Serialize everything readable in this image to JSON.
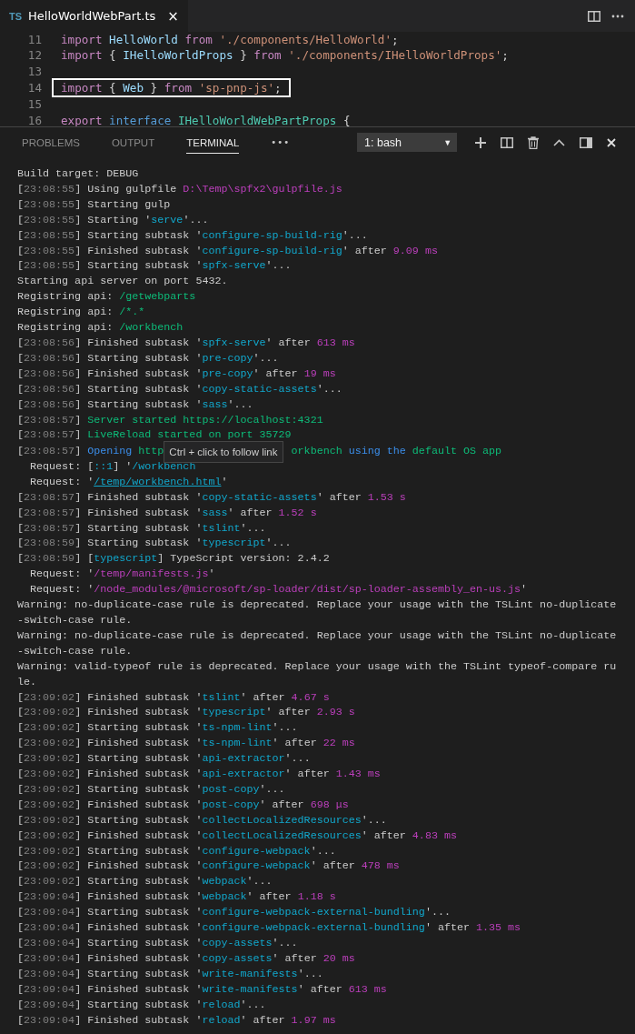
{
  "editor_tab": {
    "badge": "TS",
    "title": "HelloWorldWebPart.ts",
    "close": "×",
    "selected": true
  },
  "editor": {
    "lines": [
      {
        "number": "11",
        "highlighted": false,
        "tokens": [
          {
            "kind": "keyword",
            "text": "import "
          },
          {
            "kind": "ident",
            "text": "HelloWorld "
          },
          {
            "kind": "keyword",
            "text": "from "
          },
          {
            "kind": "string",
            "text": "'./components/HelloWorld'"
          },
          {
            "kind": "plain",
            "text": ";"
          }
        ]
      },
      {
        "number": "12",
        "highlighted": false,
        "tokens": [
          {
            "kind": "keyword",
            "text": "import"
          },
          {
            "kind": "plain",
            "text": " { "
          },
          {
            "kind": "ident",
            "text": "IHelloWorldProps"
          },
          {
            "kind": "plain",
            "text": " } "
          },
          {
            "kind": "keyword",
            "text": "from "
          },
          {
            "kind": "string",
            "text": "'./components/IHelloWorldProps'"
          },
          {
            "kind": "plain",
            "text": ";"
          }
        ]
      },
      {
        "number": "13",
        "highlighted": false
      },
      {
        "number": "14",
        "highlighted": true,
        "tokens": [
          {
            "kind": "keyword",
            "text": "import"
          },
          {
            "kind": "plain",
            "text": " { "
          },
          {
            "kind": "ident",
            "text": "Web"
          },
          {
            "kind": "plain",
            "text": " } "
          },
          {
            "kind": "keyword",
            "text": "from "
          },
          {
            "kind": "string",
            "text": "'sp-pnp-js'"
          },
          {
            "kind": "plain",
            "text": ";"
          }
        ]
      },
      {
        "number": "15",
        "highlighted": false
      },
      {
        "number": "16",
        "highlighted": false,
        "tokens": [
          {
            "kind": "keyword",
            "text": "export "
          },
          {
            "kind": "storage",
            "text": "interface "
          },
          {
            "kind": "type",
            "text": "IHelloWorldWebPartProps"
          },
          {
            "kind": "plain",
            "text": " {"
          }
        ]
      }
    ]
  },
  "panel_tabs": [
    {
      "label": "PROBLEMS",
      "selected": false
    },
    {
      "label": "OUTPUT",
      "selected": false
    },
    {
      "label": "TERMINAL",
      "selected": true
    }
  ],
  "panel_more": "•••",
  "terminal_select": {
    "value": "1: bash",
    "caret": "▼"
  },
  "terminal": [
    {
      "segments": [
        {
          "kind": "plain",
          "text": "Build target: DEBUG"
        }
      ]
    },
    {
      "time": "[23:08:55]",
      "segments": [
        {
          "kind": "plain",
          "text": " Using gulpfile "
        },
        {
          "kind": "magenta",
          "text": "D:\\Temp\\spfx2\\gulpfile.js"
        }
      ]
    },
    {
      "time": "[23:08:55]",
      "segments": [
        {
          "kind": "plain",
          "text": " Starting gulp"
        }
      ]
    },
    {
      "time": "[23:08:55]",
      "segments": [
        {
          "kind": "plain",
          "text": " Starting '"
        },
        {
          "kind": "cyan",
          "text": "serve"
        },
        {
          "kind": "plain",
          "text": "'..."
        }
      ]
    },
    {
      "time": "[23:08:55]",
      "segments": [
        {
          "kind": "plain",
          "text": " Starting subtask '"
        },
        {
          "kind": "cyan",
          "text": "configure-sp-build-rig"
        },
        {
          "kind": "plain",
          "text": "'..."
        }
      ]
    },
    {
      "time": "[23:08:55]",
      "segments": [
        {
          "kind": "plain",
          "text": " Finished subtask '"
        },
        {
          "kind": "cyan",
          "text": "configure-sp-build-rig"
        },
        {
          "kind": "plain",
          "text": "' after "
        },
        {
          "kind": "magenta",
          "text": "9.09 ms"
        }
      ]
    },
    {
      "time": "[23:08:55]",
      "segments": [
        {
          "kind": "plain",
          "text": " Starting subtask '"
        },
        {
          "kind": "cyan",
          "text": "spfx-serve"
        },
        {
          "kind": "plain",
          "text": "'..."
        }
      ]
    },
    {
      "segments": [
        {
          "kind": "plain",
          "text": "Starting api server on port 5432."
        }
      ]
    },
    {
      "segments": [
        {
          "kind": "plain",
          "text": "Registring api: "
        },
        {
          "kind": "green",
          "text": "/getwebparts"
        }
      ]
    },
    {
      "segments": [
        {
          "kind": "plain",
          "text": "Registring api: "
        },
        {
          "kind": "green",
          "text": "/*.*"
        }
      ]
    },
    {
      "segments": [
        {
          "kind": "plain",
          "text": "Registring api: "
        },
        {
          "kind": "green",
          "text": "/workbench"
        }
      ]
    },
    {
      "time": "[23:08:56]",
      "segments": [
        {
          "kind": "plain",
          "text": " Finished subtask '"
        },
        {
          "kind": "cyan",
          "text": "spfx-serve"
        },
        {
          "kind": "plain",
          "text": "' after "
        },
        {
          "kind": "magenta",
          "text": "613 ms"
        }
      ]
    },
    {
      "time": "[23:08:56]",
      "segments": [
        {
          "kind": "plain",
          "text": " Starting subtask '"
        },
        {
          "kind": "cyan",
          "text": "pre-copy"
        },
        {
          "kind": "plain",
          "text": "'..."
        }
      ]
    },
    {
      "time": "[23:08:56]",
      "segments": [
        {
          "kind": "plain",
          "text": " Finished subtask '"
        },
        {
          "kind": "cyan",
          "text": "pre-copy"
        },
        {
          "kind": "plain",
          "text": "' after "
        },
        {
          "kind": "magenta",
          "text": "19 ms"
        }
      ]
    },
    {
      "time": "[23:08:56]",
      "segments": [
        {
          "kind": "plain",
          "text": " Starting subtask '"
        },
        {
          "kind": "cyan",
          "text": "copy-static-assets"
        },
        {
          "kind": "plain",
          "text": "'..."
        }
      ]
    },
    {
      "time": "[23:08:56]",
      "segments": [
        {
          "kind": "plain",
          "text": " Starting subtask '"
        },
        {
          "kind": "cyan",
          "text": "sass"
        },
        {
          "kind": "plain",
          "text": "'..."
        }
      ]
    },
    {
      "time": "[23:08:57]",
      "segments": [
        {
          "kind": "green",
          "text": " Server started https://localhost:4321"
        }
      ]
    },
    {
      "time": "[23:08:57]",
      "segments": [
        {
          "kind": "green",
          "text": " LiveReload started on port 35729"
        }
      ]
    },
    {
      "time": "[23:08:57]",
      "segments": [
        {
          "kind": "blue",
          "text": " Opening "
        },
        {
          "kind": "green",
          "text": "http"
        },
        {
          "kind": "tooltip",
          "text": "Ctrl + click to follow link"
        },
        {
          "kind": "green",
          "text": "orkbench "
        },
        {
          "kind": "blue",
          "text": "using the "
        },
        {
          "kind": "green",
          "text": "default OS app"
        }
      ]
    },
    {
      "segments": [
        {
          "kind": "plain",
          "text": "  Request: ["
        },
        {
          "kind": "cyan",
          "text": "::1"
        },
        {
          "kind": "plain",
          "text": "] '"
        },
        {
          "kind": "cyan",
          "text": "/workbench"
        }
      ]
    },
    {
      "segments": [
        {
          "kind": "plain",
          "text": "  Request: '"
        },
        {
          "kind": "link",
          "text": "/temp/workbench.html"
        },
        {
          "kind": "plain",
          "text": "'"
        }
      ]
    },
    {
      "time": "[23:08:57]",
      "segments": [
        {
          "kind": "plain",
          "text": " Finished subtask '"
        },
        {
          "kind": "cyan",
          "text": "copy-static-assets"
        },
        {
          "kind": "plain",
          "text": "' after "
        },
        {
          "kind": "magenta",
          "text": "1.53 s"
        }
      ]
    },
    {
      "time": "[23:08:57]",
      "segments": [
        {
          "kind": "plain",
          "text": " Finished subtask '"
        },
        {
          "kind": "cyan",
          "text": "sass"
        },
        {
          "kind": "plain",
          "text": "' after "
        },
        {
          "kind": "magenta",
          "text": "1.52 s"
        }
      ]
    },
    {
      "time": "[23:08:57]",
      "segments": [
        {
          "kind": "plain",
          "text": " Starting subtask '"
        },
        {
          "kind": "cyan",
          "text": "tslint"
        },
        {
          "kind": "plain",
          "text": "'..."
        }
      ]
    },
    {
      "time": "[23:08:59]",
      "segments": [
        {
          "kind": "plain",
          "text": " Starting subtask '"
        },
        {
          "kind": "cyan",
          "text": "typescript"
        },
        {
          "kind": "plain",
          "text": "'..."
        }
      ]
    },
    {
      "time": "[23:08:59]",
      "segments": [
        {
          "kind": "plain",
          "text": " ["
        },
        {
          "kind": "cyan",
          "text": "typescript"
        },
        {
          "kind": "plain",
          "text": "] TypeScript version: 2.4.2"
        }
      ]
    },
    {
      "segments": [
        {
          "kind": "plain",
          "text": "  Request: '"
        },
        {
          "kind": "magenta",
          "text": "/temp/manifests.js"
        },
        {
          "kind": "plain",
          "text": "'"
        }
      ]
    },
    {
      "segments": [
        {
          "kind": "plain",
          "text": "  Request: '"
        },
        {
          "kind": "magenta",
          "text": "/node_modules/@microsoft/sp-loader/dist/sp-loader-assembly_en-us.js"
        },
        {
          "kind": "plain",
          "text": "'"
        }
      ]
    },
    {
      "segments": [
        {
          "kind": "plain",
          "text": "Warning: no-duplicate-case rule is deprecated. Replace your usage with the TSLint no-duplicate-switch-case rule."
        }
      ]
    },
    {
      "segments": [
        {
          "kind": "plain",
          "text": "Warning: no-duplicate-case rule is deprecated. Replace your usage with the TSLint no-duplicate-switch-case rule."
        }
      ]
    },
    {
      "segments": [
        {
          "kind": "plain",
          "text": "Warning: valid-typeof rule is deprecated. Replace your usage with the TSLint typeof-compare rule."
        }
      ]
    },
    {
      "time": "[23:09:02]",
      "segments": [
        {
          "kind": "plain",
          "text": " Finished subtask '"
        },
        {
          "kind": "cyan",
          "text": "tslint"
        },
        {
          "kind": "plain",
          "text": "' after "
        },
        {
          "kind": "magenta",
          "text": "4.67 s"
        }
      ]
    },
    {
      "time": "[23:09:02]",
      "segments": [
        {
          "kind": "plain",
          "text": " Finished subtask '"
        },
        {
          "kind": "cyan",
          "text": "typescript"
        },
        {
          "kind": "plain",
          "text": "' after "
        },
        {
          "kind": "magenta",
          "text": "2.93 s"
        }
      ]
    },
    {
      "time": "[23:09:02]",
      "segments": [
        {
          "kind": "plain",
          "text": " Starting subtask '"
        },
        {
          "kind": "cyan",
          "text": "ts-npm-lint"
        },
        {
          "kind": "plain",
          "text": "'..."
        }
      ]
    },
    {
      "time": "[23:09:02]",
      "segments": [
        {
          "kind": "plain",
          "text": " Finished subtask '"
        },
        {
          "kind": "cyan",
          "text": "ts-npm-lint"
        },
        {
          "kind": "plain",
          "text": "' after "
        },
        {
          "kind": "magenta",
          "text": "22 ms"
        }
      ]
    },
    {
      "time": "[23:09:02]",
      "segments": [
        {
          "kind": "plain",
          "text": " Starting subtask '"
        },
        {
          "kind": "cyan",
          "text": "api-extractor"
        },
        {
          "kind": "plain",
          "text": "'..."
        }
      ]
    },
    {
      "time": "[23:09:02]",
      "segments": [
        {
          "kind": "plain",
          "text": " Finished subtask '"
        },
        {
          "kind": "cyan",
          "text": "api-extractor"
        },
        {
          "kind": "plain",
          "text": "' after "
        },
        {
          "kind": "magenta",
          "text": "1.43 ms"
        }
      ]
    },
    {
      "time": "[23:09:02]",
      "segments": [
        {
          "kind": "plain",
          "text": " Starting subtask '"
        },
        {
          "kind": "cyan",
          "text": "post-copy"
        },
        {
          "kind": "plain",
          "text": "'..."
        }
      ]
    },
    {
      "time": "[23:09:02]",
      "segments": [
        {
          "kind": "plain",
          "text": " Finished subtask '"
        },
        {
          "kind": "cyan",
          "text": "post-copy"
        },
        {
          "kind": "plain",
          "text": "' after "
        },
        {
          "kind": "magenta",
          "text": "698 μs"
        }
      ]
    },
    {
      "time": "[23:09:02]",
      "segments": [
        {
          "kind": "plain",
          "text": " Starting subtask '"
        },
        {
          "kind": "cyan",
          "text": "collectLocalizedResources"
        },
        {
          "kind": "plain",
          "text": "'..."
        }
      ]
    },
    {
      "time": "[23:09:02]",
      "segments": [
        {
          "kind": "plain",
          "text": " Finished subtask '"
        },
        {
          "kind": "cyan",
          "text": "collectLocalizedResources"
        },
        {
          "kind": "plain",
          "text": "' after "
        },
        {
          "kind": "magenta",
          "text": "4.83 ms"
        }
      ]
    },
    {
      "time": "[23:09:02]",
      "segments": [
        {
          "kind": "plain",
          "text": " Starting subtask '"
        },
        {
          "kind": "cyan",
          "text": "configure-webpack"
        },
        {
          "kind": "plain",
          "text": "'..."
        }
      ]
    },
    {
      "time": "[23:09:02]",
      "segments": [
        {
          "kind": "plain",
          "text": " Finished subtask '"
        },
        {
          "kind": "cyan",
          "text": "configure-webpack"
        },
        {
          "kind": "plain",
          "text": "' after "
        },
        {
          "kind": "magenta",
          "text": "478 ms"
        }
      ]
    },
    {
      "time": "[23:09:02]",
      "segments": [
        {
          "kind": "plain",
          "text": " Starting subtask '"
        },
        {
          "kind": "cyan",
          "text": "webpack"
        },
        {
          "kind": "plain",
          "text": "'..."
        }
      ]
    },
    {
      "time": "[23:09:04]",
      "segments": [
        {
          "kind": "plain",
          "text": " Finished subtask '"
        },
        {
          "kind": "cyan",
          "text": "webpack"
        },
        {
          "kind": "plain",
          "text": "' after "
        },
        {
          "kind": "magenta",
          "text": "1.18 s"
        }
      ]
    },
    {
      "time": "[23:09:04]",
      "segments": [
        {
          "kind": "plain",
          "text": " Starting subtask '"
        },
        {
          "kind": "cyan",
          "text": "configure-webpack-external-bundling"
        },
        {
          "kind": "plain",
          "text": "'..."
        }
      ]
    },
    {
      "time": "[23:09:04]",
      "segments": [
        {
          "kind": "plain",
          "text": " Finished subtask '"
        },
        {
          "kind": "cyan",
          "text": "configure-webpack-external-bundling"
        },
        {
          "kind": "plain",
          "text": "' after "
        },
        {
          "kind": "magenta",
          "text": "1.35 ms"
        }
      ]
    },
    {
      "time": "[23:09:04]",
      "segments": [
        {
          "kind": "plain",
          "text": " Starting subtask '"
        },
        {
          "kind": "cyan",
          "text": "copy-assets"
        },
        {
          "kind": "plain",
          "text": "'..."
        }
      ]
    },
    {
      "time": "[23:09:04]",
      "segments": [
        {
          "kind": "plain",
          "text": " Finished subtask '"
        },
        {
          "kind": "cyan",
          "text": "copy-assets"
        },
        {
          "kind": "plain",
          "text": "' after "
        },
        {
          "kind": "magenta",
          "text": "20 ms"
        }
      ]
    },
    {
      "time": "[23:09:04]",
      "segments": [
        {
          "kind": "plain",
          "text": " Starting subtask '"
        },
        {
          "kind": "cyan",
          "text": "write-manifests"
        },
        {
          "kind": "plain",
          "text": "'..."
        }
      ]
    },
    {
      "time": "[23:09:04]",
      "segments": [
        {
          "kind": "plain",
          "text": " Finished subtask '"
        },
        {
          "kind": "cyan",
          "text": "write-manifests"
        },
        {
          "kind": "plain",
          "text": "' after "
        },
        {
          "kind": "magenta",
          "text": "613 ms"
        }
      ]
    },
    {
      "time": "[23:09:04]",
      "segments": [
        {
          "kind": "plain",
          "text": " Starting subtask '"
        },
        {
          "kind": "cyan",
          "text": "reload"
        },
        {
          "kind": "plain",
          "text": "'..."
        }
      ]
    },
    {
      "time": "[23:09:04]",
      "segments": [
        {
          "kind": "plain",
          "text": " Finished subtask '"
        },
        {
          "kind": "cyan",
          "text": "reload"
        },
        {
          "kind": "plain",
          "text": "' after "
        },
        {
          "kind": "magenta",
          "text": "1.97 ms"
        }
      ]
    }
  ]
}
